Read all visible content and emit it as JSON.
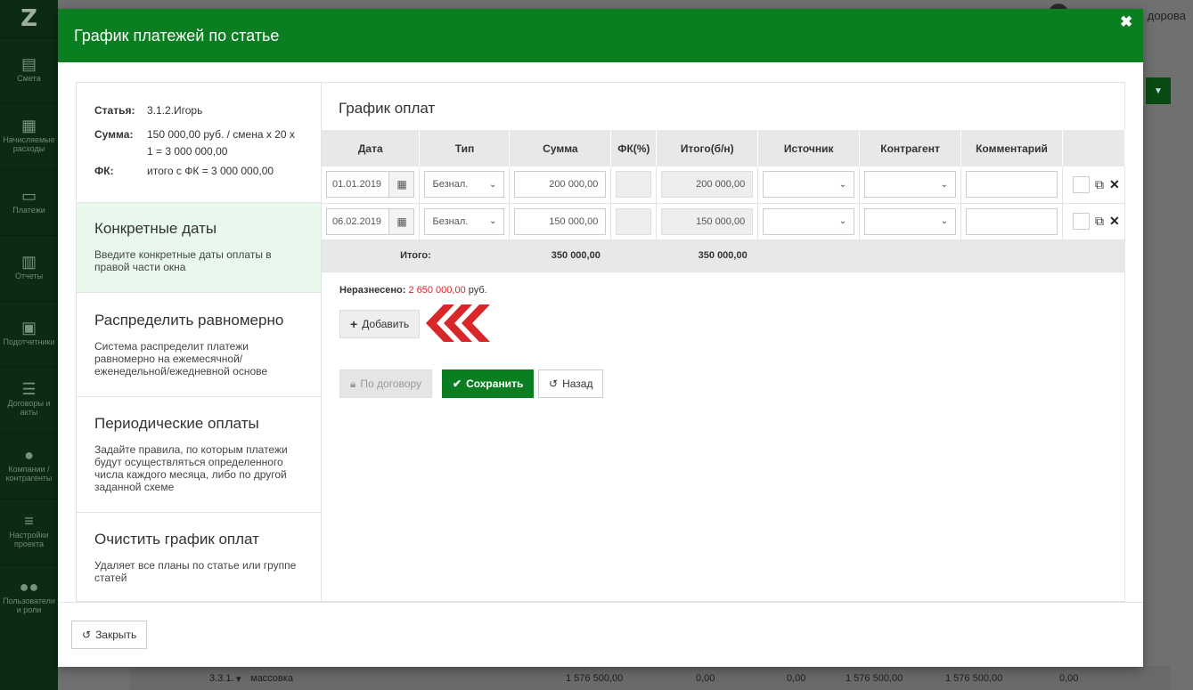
{
  "background": {
    "logo": "Z",
    "user_name": "дорова",
    "sidebar": [
      {
        "label": "Смета",
        "icon": "book-icon"
      },
      {
        "label": "Начисляемые расходы",
        "icon": "calendar-icon"
      },
      {
        "label": "Платежи",
        "icon": "payments-icon"
      },
      {
        "label": "Отчеты",
        "icon": "bar-chart-icon"
      },
      {
        "label": "Подотчетники",
        "icon": "briefcase-icon"
      },
      {
        "label": "Договоры и акты",
        "icon": "list-icon"
      },
      {
        "label": "Компании / контрагенты",
        "icon": "user-icon"
      },
      {
        "label": "Настройки проекта",
        "icon": "sliders-icon"
      },
      {
        "label": "Пользователи и роли",
        "icon": "users-icon"
      }
    ],
    "bottom_row": {
      "code": "3.3.1.",
      "name": "массовка",
      "v1": "1 576 500,00",
      "v2": "0,00",
      "v3": "0,00",
      "v4": "1 576 500,00",
      "v5": "1 576 500,00",
      "v6": "0,00"
    }
  },
  "modal": {
    "title": "График платежей по статье",
    "close_glyph": "✖",
    "info": {
      "article_label": "Статья:",
      "article_value": "3.1.2.Игорь",
      "sum_label": "Сумма:",
      "sum_value": "150 000,00 руб. / смена х 20 х 1 = 3 000 000,00",
      "fk_label": "ФК:",
      "fk_value": "итого с ФК = 3 000 000,00"
    },
    "options": [
      {
        "title": "Конкретные даты",
        "desc": "Введите конкретные даты оплаты в правой части окна"
      },
      {
        "title": "Распределить равномерно",
        "desc": "Система распределит платежи равномерно на ежемесячной/ еженедельной/ежедневной основе"
      },
      {
        "title": "Периодические оплаты",
        "desc": "Задайте правила, по которым платежи будут осуществляться определенного числа каждого месяца, либо по другой заданной схеме"
      },
      {
        "title": "Очистить график оплат",
        "desc": "Удаляет все планы по статье или группе статей"
      }
    ],
    "schedule": {
      "title": "График оплат",
      "columns": [
        "Дата",
        "Тип",
        "Сумма",
        "ФК(%)",
        "Итого(б/н)",
        "Источник",
        "Контрагент",
        "Комментарий"
      ],
      "rows": [
        {
          "date": "01.01.2019",
          "type": "Безнал.",
          "sum": "200 000,00",
          "fk": "",
          "total": "200 000,00",
          "source": "",
          "contractor": "",
          "comment": ""
        },
        {
          "date": "06.02.2019",
          "type": "Безнал.",
          "sum": "150 000,00",
          "fk": "",
          "total": "150 000,00",
          "source": "",
          "contractor": "",
          "comment": ""
        }
      ],
      "total_label": "Итого:",
      "total_sum": "350 000,00",
      "total_total": "350 000,00",
      "unassigned_label": "Неразнесено:",
      "unassigned_value": "2 650 000,00",
      "unassigned_unit": "руб.",
      "add_label": "Добавить",
      "contract_label": "По договору",
      "save_label": "Сохранить",
      "back_label": "Назад"
    },
    "footer_close_label": "Закрыть",
    "colors": {
      "header": "#0a7f21",
      "accent_red": "#d8262b",
      "active_option": "#e9f8ec"
    }
  }
}
